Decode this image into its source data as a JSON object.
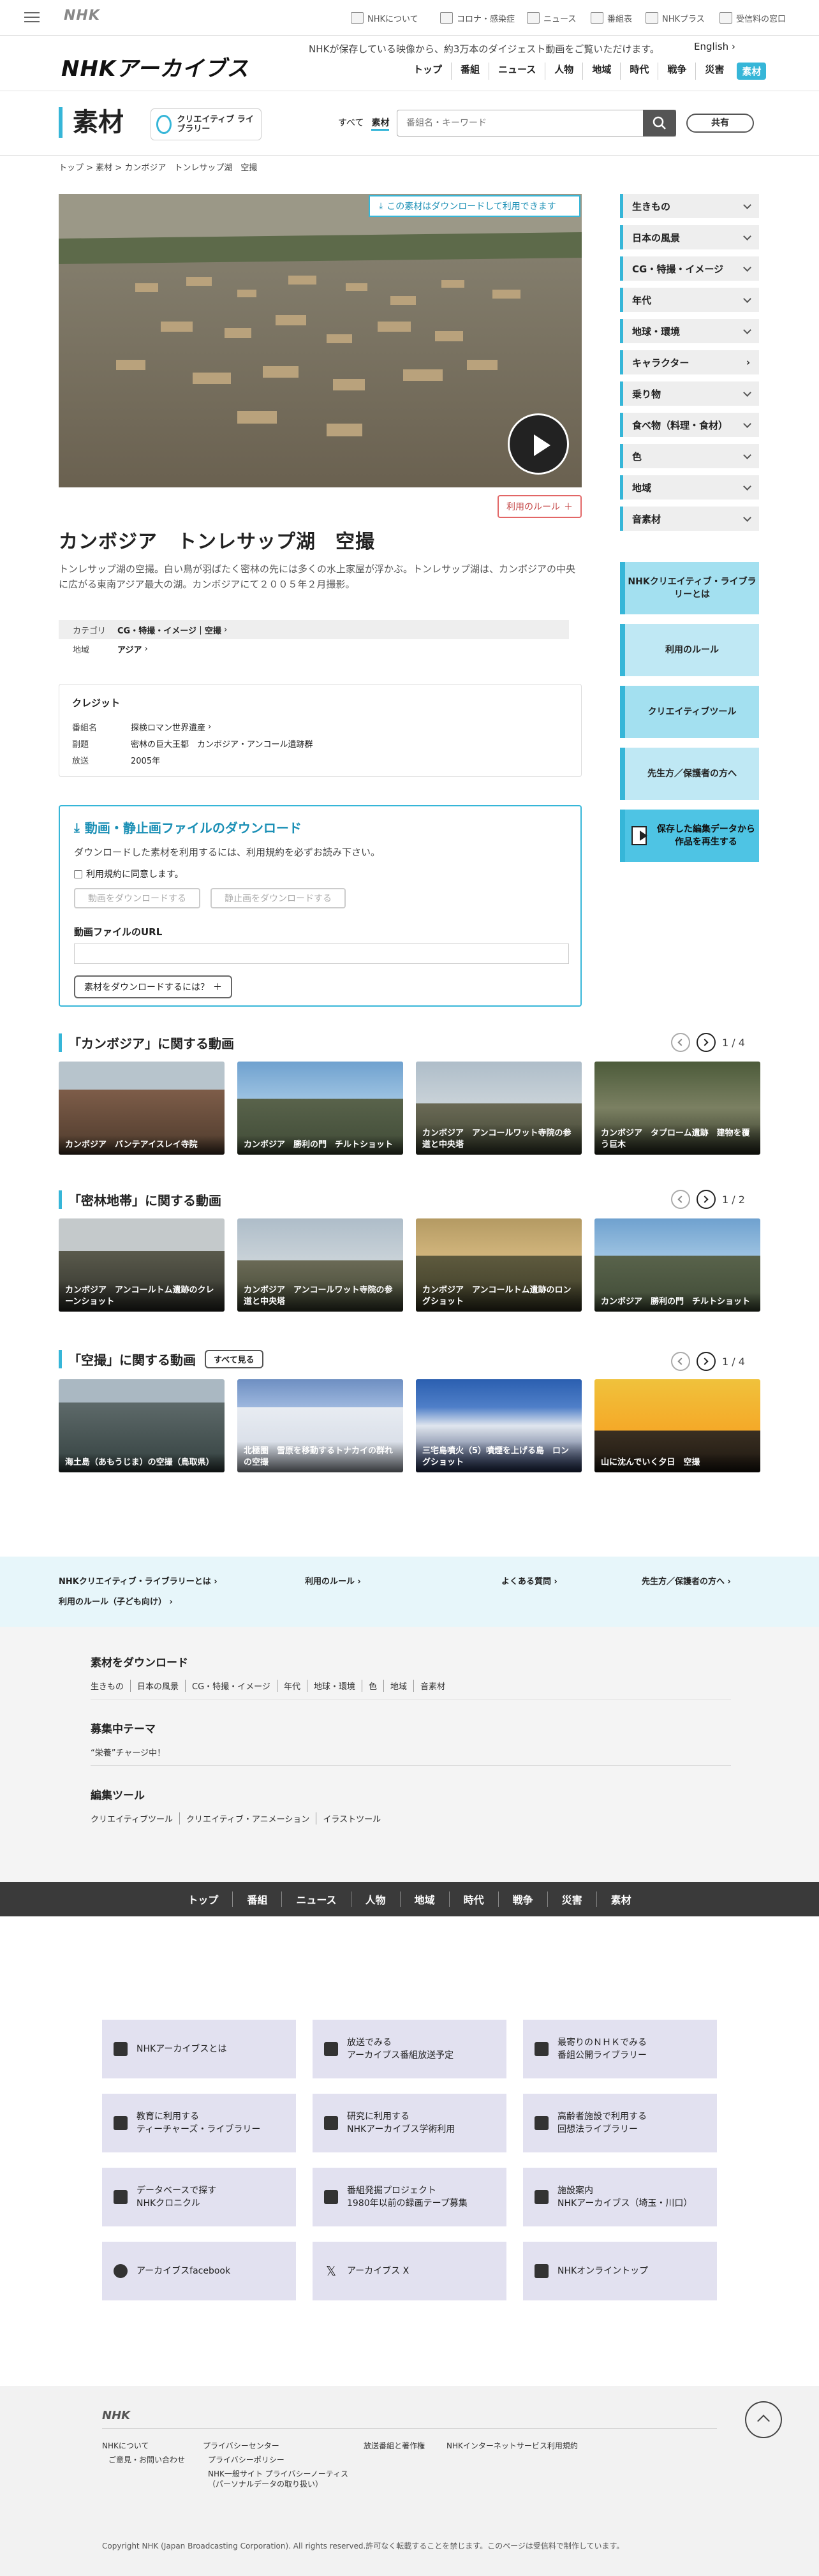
{
  "topbar": {
    "logo": "NHK",
    "links": [
      "NHKについて",
      "コロナ・感染症",
      "ニュース",
      "番組表",
      "NHKプラス",
      "受信料の窓口"
    ]
  },
  "header": {
    "logo": "NHKアーカイブス",
    "tagline": "NHKが保存している映像から、約3万本のダイジェスト動画をご覧いただけます。",
    "lang": "English",
    "nav": [
      "トップ",
      "番組",
      "ニュース",
      "人物",
      "地域",
      "時代",
      "戦争",
      "災害",
      "素材"
    ]
  },
  "section": {
    "title": "素材",
    "creative_logo": "クリエイティブ ライブラリー",
    "tabs": [
      "すべて",
      "素材"
    ],
    "search_placeholder": "番組名・キーワード",
    "share": "共有"
  },
  "breadcrumb": "トップ > 素材 > カンボジア　トンレサップ湖　空撮",
  "hero": {
    "download_badge": "この素材はダウンロードして利用できます",
    "rule_button": "利用のルール"
  },
  "detail": {
    "title": "カンボジア　トンレサップ湖　空撮",
    "desc": "トンレサップ湖の空撮。白い鳥が羽ばたく密林の先には多くの水上家屋が浮かぶ。トンレサップ湖は、カンボジアの中央に広がる東南アジア最大の湖。カンボジアにて２００５年２月撮影。",
    "meta": [
      {
        "k": "カテゴリ",
        "v": "CG・特撮・イメージ｜空撮"
      },
      {
        "k": "地域",
        "v": "アジア"
      }
    ],
    "credit_title": "クレジット",
    "credits": [
      {
        "k": "番組名",
        "v": "探検ロマン世界遺産"
      },
      {
        "k": "副題",
        "v": "密林の巨大王都　カンボジア・アンコール遺跡群"
      },
      {
        "k": "放送",
        "v": "2005年"
      }
    ]
  },
  "download": {
    "title": "動画・静止画ファイルのダウンロード",
    "note": "ダウンロードした素材を利用するには、利用規約を必ずお読み下さい。",
    "agree": "利用規約に同意します。",
    "btn_video": "動画をダウンロードする",
    "btn_still": "静止画をダウンロードする",
    "url_label": "動画ファイルのURL",
    "how": "素材をダウンロードするには？"
  },
  "sidebar": {
    "accordions": [
      "生きもの",
      "日本の風景",
      "CG・特撮・イメージ",
      "年代",
      "地球・環境",
      "キャラクター",
      "乗り物",
      "食べ物（料理・食材）",
      "色",
      "地域",
      "音素材"
    ],
    "promos": [
      "NHKクリエイティブ・ライブラリーとは",
      "利用のルール",
      "クリエイティブツール",
      "先生方／保護者の方へ",
      "保存した編集データから作品を再生する"
    ]
  },
  "related": [
    {
      "title": "「カンボジア」に関する動画",
      "page": "1 / 4",
      "items": [
        "カンボジア　バンテアイスレイ寺院",
        "カンボジア　勝利の門　チルトショット",
        "カンボジア　アンコールワット寺院の参道と中央塔",
        "カンボジア　タプローム遺跡　建物を覆う巨木"
      ]
    },
    {
      "title": "「密林地帯」に関する動画",
      "page": "1 / 2",
      "items": [
        "カンボジア　アンコールトム遺跡のクレーンショット",
        "カンボジア　アンコールワット寺院の参道と中央塔",
        "カンボジア　アンコールトム遺跡のロングショット",
        "カンボジア　勝利の門　チルトショット"
      ]
    },
    {
      "title": "「空撮」に関する動画",
      "see_all": "すべて見る",
      "page": "1 / 4",
      "items": [
        "海土島（あもうじま）の空撮（鳥取県）",
        "北極圏　雪原を移動するトナカイの群れの空撮",
        "三宅島噴火（5）噴煙を上げる島　ロングショット",
        "山に沈んでいく夕日　空撮"
      ]
    }
  ],
  "footer_nav": {
    "links": [
      "NHKクリエイティブ・ライブラリーとは",
      "利用のルール",
      "よくある質問",
      "先生方／保護者の方へ",
      "利用のルール（子ども向け）"
    ],
    "sections": [
      {
        "title": "素材をダウンロード",
        "items": [
          "生きもの",
          "日本の風景",
          "CG・特撮・イメージ",
          "年代",
          "地球・環境",
          "色",
          "地域",
          "音素材"
        ]
      },
      {
        "title": "募集中テーマ",
        "items": [
          "“栄養”チャージ中！"
        ]
      },
      {
        "title": "編集ツール",
        "items": [
          "クリエイティブツール",
          "クリエイティブ・アニメーション",
          "イラストツール"
        ]
      }
    ],
    "dark_nav": [
      "トップ",
      "番組",
      "ニュース",
      "人物",
      "地域",
      "時代",
      "戦争",
      "災害",
      "素材"
    ]
  },
  "tiles": [
    {
      "l1": "NHKアーカイブスとは",
      "l2": ""
    },
    {
      "l1": "放送でみる",
      "l2": "アーカイブス番組放送予定"
    },
    {
      "l1": "最寄りのＮＨＫでみる",
      "l2": "番組公開ライブラリー"
    },
    {
      "l1": "教育に利用する",
      "l2": "ティーチャーズ・ライブラリー"
    },
    {
      "l1": "研究に利用する",
      "l2": "NHKアーカイブス学術利用"
    },
    {
      "l1": "高齢者施設で利用する",
      "l2": "回想法ライブラリー"
    },
    {
      "l1": "データベースで探す",
      "l2": "NHKクロニクル"
    },
    {
      "l1": "番組発掘プロジェクト",
      "l2": "1980年以前の録画テープ募集"
    },
    {
      "l1": "施設案内",
      "l2": "NHKアーカイブス（埼玉・川口）"
    },
    {
      "l1": "アーカイブスfacebook",
      "l2": ""
    },
    {
      "l1": "アーカイブス X",
      "l2": ""
    },
    {
      "l1": "NHKオンライントップ",
      "l2": ""
    }
  ],
  "footer": {
    "logo": "NHK",
    "links": [
      "NHKについて",
      "ご意見・お問い合わせ",
      "プライバシーセンター",
      "プライバシーポリシー",
      "NHK一般サイト プライバシーノーティス",
      "（パーソナルデータの取り扱い）",
      "放送番組と著作権",
      "NHKインターネットサービス利用規約"
    ],
    "copyright": "Copyright NHK (Japan Broadcasting Corporation). All rights reserved.許可なく転載することを禁じます。このページは受信料で制作しています。"
  }
}
